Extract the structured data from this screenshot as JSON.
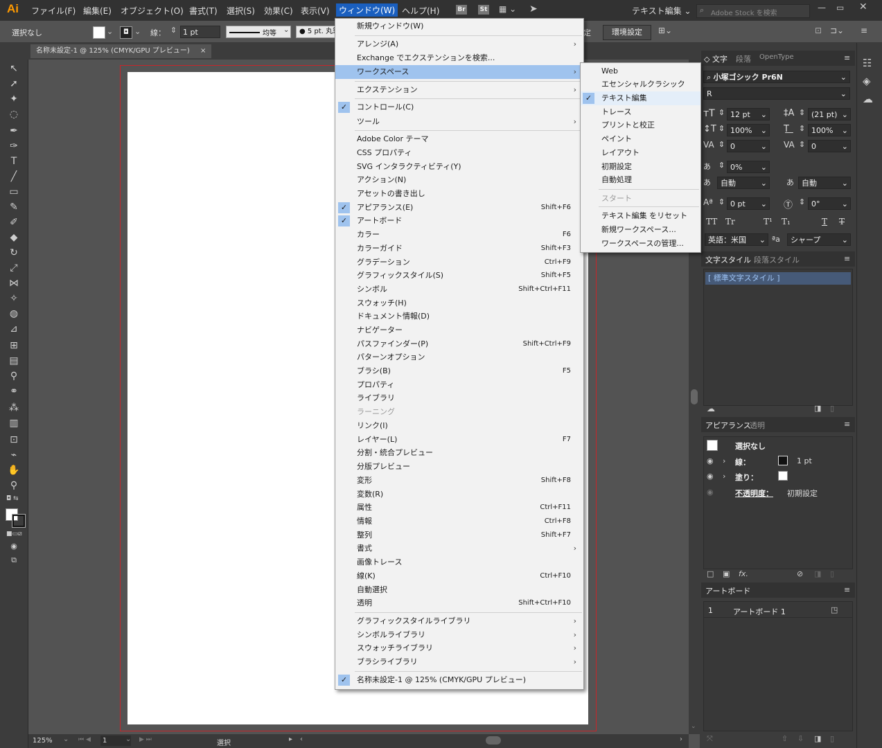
{
  "app": {
    "logo": "Ai"
  },
  "menubar": {
    "items": [
      "ファイル(F)",
      "編集(E)",
      "オブジェクト(O)",
      "書式(T)",
      "選択(S)",
      "効果(C)",
      "表示(V)",
      "ウィンドウ(W)",
      "ヘルプ(H)"
    ],
    "bridge": "Br",
    "stock": "St",
    "workspace": "テキスト編集",
    "search_placeholder": "Adobe Stock を検索"
  },
  "controlbar": {
    "selection": "選択なし",
    "stroke_label": "線：",
    "stroke_value": "1 pt",
    "stroke_style": "均等",
    "brush": "5 pt. 丸筆",
    "document_setup_partial": "定",
    "preferences": "環境設定"
  },
  "document": {
    "tab": "名称未設定-1 @ 125% (CMYK/GPU プレビュー)",
    "close": "×"
  },
  "statusbar": {
    "zoom": "125%",
    "artboard": "1",
    "mode": "選択"
  },
  "window_menu": {
    "items": [
      {
        "label": "新規ウィンドウ(W)"
      },
      {
        "label": "アレンジ(A)",
        "submenu": true
      },
      {
        "label": "Exchange でエクステンションを検索..."
      },
      {
        "label": "ワークスペース",
        "submenu": true,
        "highlighted": true
      },
      {
        "label": "エクステンション",
        "submenu": true
      },
      {
        "label": "コントロール(C)",
        "checked": true
      },
      {
        "label": "ツール",
        "submenu": true
      },
      {
        "label": "Adobe Color テーマ"
      },
      {
        "label": "CSS プロパティ"
      },
      {
        "label": "SVG インタラクティビティ(Y)"
      },
      {
        "label": "アクション(N)"
      },
      {
        "label": "アセットの書き出し"
      },
      {
        "label": "アピアランス(E)",
        "shortcut": "Shift+F6",
        "checked": true
      },
      {
        "label": "アートボード",
        "checked": true
      },
      {
        "label": "カラー",
        "shortcut": "F6"
      },
      {
        "label": "カラーガイド",
        "shortcut": "Shift+F3"
      },
      {
        "label": "グラデーション",
        "shortcut": "Ctrl+F9"
      },
      {
        "label": "グラフィックスタイル(S)",
        "shortcut": "Shift+F5"
      },
      {
        "label": "シンボル",
        "shortcut": "Shift+Ctrl+F11"
      },
      {
        "label": "スウォッチ(H)"
      },
      {
        "label": "ドキュメント情報(D)"
      },
      {
        "label": "ナビゲーター"
      },
      {
        "label": "パスファインダー(P)",
        "shortcut": "Shift+Ctrl+F9"
      },
      {
        "label": "パターンオプション"
      },
      {
        "label": "ブラシ(B)",
        "shortcut": "F5"
      },
      {
        "label": "プロパティ"
      },
      {
        "label": "ライブラリ"
      },
      {
        "label": "ラーニング",
        "disabled": true
      },
      {
        "label": "リンク(I)"
      },
      {
        "label": "レイヤー(L)",
        "shortcut": "F7"
      },
      {
        "label": "分割・統合プレビュー"
      },
      {
        "label": "分版プレビュー"
      },
      {
        "label": "変形",
        "shortcut": "Shift+F8"
      },
      {
        "label": "変数(R)"
      },
      {
        "label": "属性",
        "shortcut": "Ctrl+F11"
      },
      {
        "label": "情報",
        "shortcut": "Ctrl+F8"
      },
      {
        "label": "整列",
        "shortcut": "Shift+F7"
      },
      {
        "label": "書式",
        "submenu": true
      },
      {
        "label": "画像トレース"
      },
      {
        "label": "線(K)",
        "shortcut": "Ctrl+F10"
      },
      {
        "label": "自動選択"
      },
      {
        "label": "透明",
        "shortcut": "Shift+Ctrl+F10"
      },
      {
        "label": "グラフィックスタイルライブラリ",
        "submenu": true
      },
      {
        "label": "シンボルライブラリ",
        "submenu": true
      },
      {
        "label": "スウォッチライブラリ",
        "submenu": true
      },
      {
        "label": "ブラシライブラリ",
        "submenu": true
      },
      {
        "label": "名称未設定-1 @ 125% (CMYK/GPU プレビュー)",
        "checked": true
      }
    ]
  },
  "workspace_menu": {
    "items": [
      {
        "label": "Web"
      },
      {
        "label": "エセンシャルクラシック"
      },
      {
        "label": "テキスト編集",
        "checked": true
      },
      {
        "label": "トレース"
      },
      {
        "label": "プリントと校正"
      },
      {
        "label": "ペイント"
      },
      {
        "label": "レイアウト"
      },
      {
        "label": "初期設定"
      },
      {
        "label": "自動処理"
      },
      {
        "label": "スタート",
        "disabled": true
      },
      {
        "label": "テキスト編集 をリセット"
      },
      {
        "label": "新規ワークスペース..."
      },
      {
        "label": "ワークスペースの管理..."
      }
    ]
  },
  "character_panel": {
    "tabs": [
      "文字",
      "段落",
      "OpenType"
    ],
    "font_family": "小塚ゴシック Pr6N",
    "font_style": "R",
    "font_size": "12 pt",
    "leading": "(21 pt)",
    "vertical_scale": "100%",
    "horizontal_scale": "100%",
    "kerning": "0",
    "tracking": "0",
    "tsume": "0%",
    "aki_left": "自動",
    "aki_right": "自動",
    "baseline_shift": "0 pt",
    "rotation": "0°",
    "language": "英語：米国",
    "antialias_label": "ªa",
    "antialias": "シャープ",
    "caps_buttons": [
      "TT",
      "Tr",
      "T¹",
      "T₁",
      "T",
      "T"
    ]
  },
  "char_style_panel": {
    "tabs": [
      "文字スタイル",
      "段落スタイル"
    ],
    "items": [
      "[ 標準文字スタイル ]"
    ]
  },
  "appearance_panel": {
    "tabs": [
      "アピアランス",
      "透明"
    ],
    "header": "選択なし",
    "rows": [
      {
        "label": "線：",
        "value": "1 pt"
      },
      {
        "label": "塗り："
      },
      {
        "label": "不透明度：",
        "value": "初期設定"
      }
    ],
    "fx": "fx."
  },
  "artboard_panel": {
    "title": "アートボード",
    "rows": [
      {
        "index": "1",
        "name": "アートボード 1"
      }
    ]
  }
}
